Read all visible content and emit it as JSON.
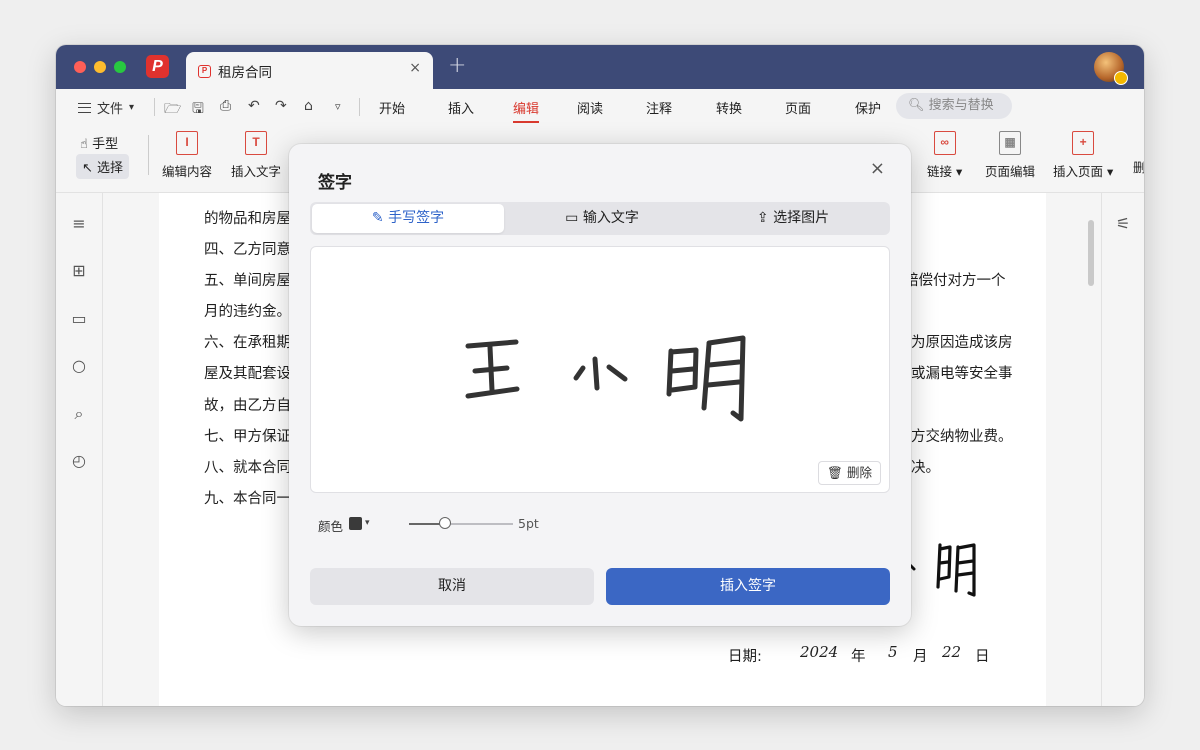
{
  "titlebar": {
    "tab_title": "租房合同",
    "tab_close": "×",
    "new_tab": "+"
  },
  "menubar": {
    "file_label": "文件",
    "tabs": [
      "开始",
      "插入",
      "编辑",
      "阅读",
      "注释",
      "转换",
      "页面",
      "保护"
    ],
    "active_tab": "编辑",
    "search_placeholder": "搜索与替换"
  },
  "toolbar": {
    "hand": "手型",
    "select": "选择",
    "tools": [
      "编辑内容",
      "插入文字",
      "链接 ▾",
      "页面编辑",
      "插入页面 ▾",
      "删"
    ]
  },
  "document": {
    "lines": [
      "的物品和房屋",
      "四、乙方同意",
      "五、单间房屋",
      "月的违约金。",
      "六、在承租期",
      "屋及其配套设",
      "故，由乙方自",
      "七、甲方保证",
      "八、就本合同",
      "九、本合同一"
    ],
    "right_fragments": [
      "赔偿付对方一个",
      "为原因造成该房",
      "或漏电等安全事",
      "方交纳物业费。",
      "决。"
    ],
    "date_label": "日期:",
    "date_year": "2024",
    "date_year_unit": "年",
    "date_month": "5",
    "date_month_unit": "月",
    "date_day": "22",
    "date_day_unit": "日"
  },
  "dialog": {
    "title": "签字",
    "close": "×",
    "tabs": [
      "手写签字",
      "输入文字",
      "选择图片"
    ],
    "active_tab": "手写签字",
    "clear_label": "删除",
    "color_label": "颜色",
    "color_value": "#3a3a3a",
    "size_value": "5pt",
    "cancel_label": "取消",
    "confirm_label": "插入签字"
  },
  "colors": {
    "accent": "#3b67c4",
    "brand_red": "#e0322e",
    "titlebar": "#3d4a77"
  }
}
